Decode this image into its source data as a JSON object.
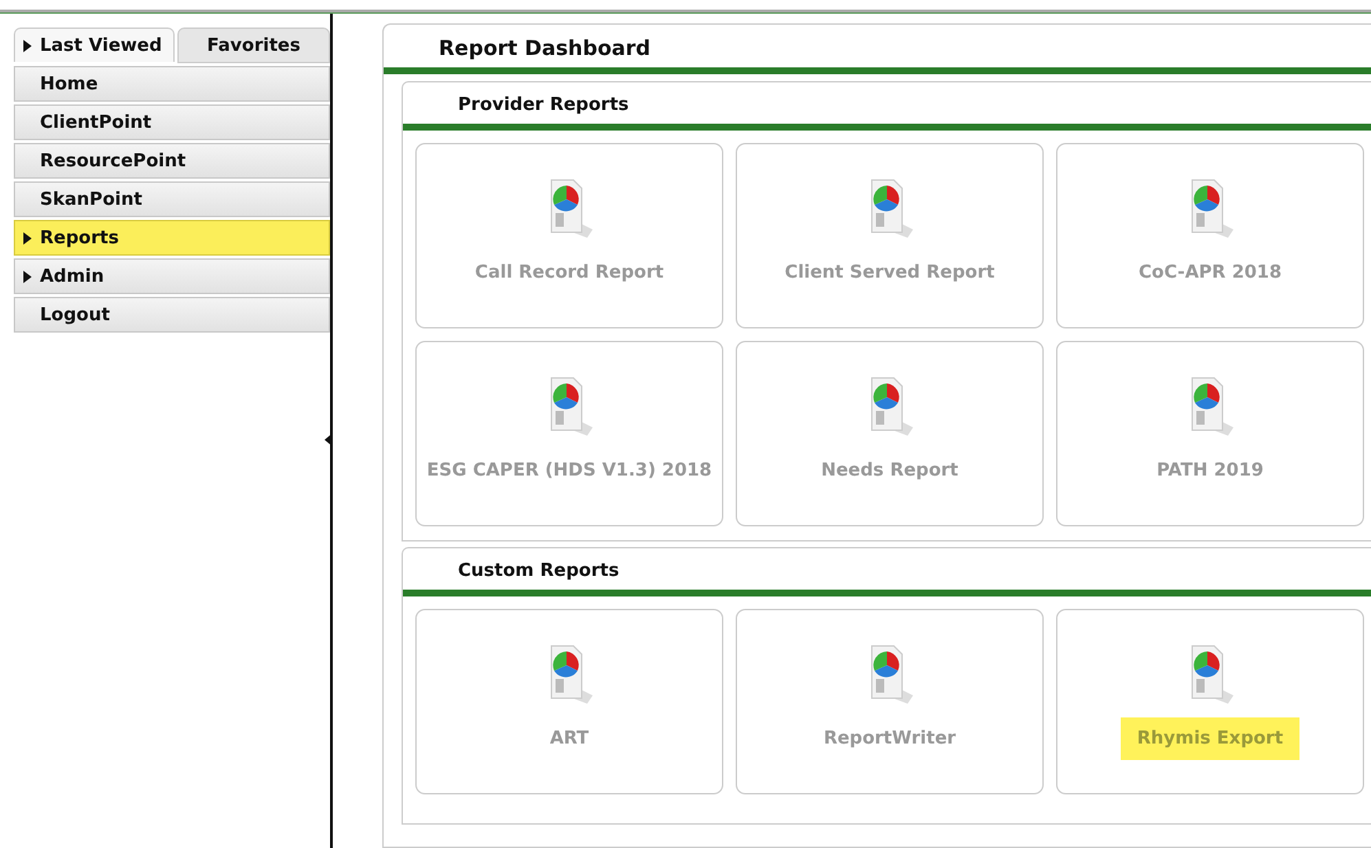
{
  "sidebar": {
    "tabs": [
      {
        "label": "Last Viewed",
        "selected": true,
        "has_arrow": true
      },
      {
        "label": "Favorites",
        "selected": false,
        "has_arrow": false
      }
    ],
    "items": [
      {
        "label": "Home",
        "has_arrow": false,
        "highlighted": false
      },
      {
        "label": "ClientPoint",
        "has_arrow": false,
        "highlighted": false
      },
      {
        "label": "ResourcePoint",
        "has_arrow": false,
        "highlighted": false
      },
      {
        "label": "SkanPoint",
        "has_arrow": false,
        "highlighted": false
      },
      {
        "label": "Reports",
        "has_arrow": true,
        "highlighted": true
      },
      {
        "label": "Admin",
        "has_arrow": true,
        "highlighted": false
      },
      {
        "label": "Logout",
        "has_arrow": false,
        "highlighted": false
      }
    ]
  },
  "dashboard": {
    "title": "Report Dashboard",
    "sections": [
      {
        "title": "Provider Reports",
        "reports": [
          {
            "label": "Call Record Report",
            "highlighted": false
          },
          {
            "label": "Client Served Report",
            "highlighted": false
          },
          {
            "label": "CoC-APR 2018",
            "highlighted": false
          },
          {
            "label": "ESG CAPER (HDS V1.3) 2018",
            "highlighted": false
          },
          {
            "label": "Needs Report",
            "highlighted": false
          },
          {
            "label": "PATH 2019",
            "highlighted": false
          }
        ]
      },
      {
        "title": "Custom Reports",
        "reports": [
          {
            "label": "ART",
            "highlighted": false
          },
          {
            "label": "ReportWriter",
            "highlighted": false
          },
          {
            "label": "Rhymis Export",
            "highlighted": true
          }
        ]
      }
    ]
  }
}
